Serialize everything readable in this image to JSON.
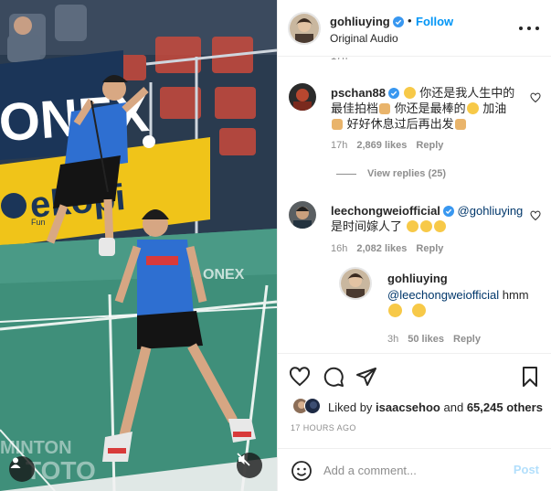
{
  "media": {
    "banner_left": "ONEX",
    "banner_sponsor": "ekopi",
    "banner_small": "Fun",
    "banner_court": "ONEX",
    "watermark_1": "MINTON",
    "watermark_2": "TOTO",
    "colors": {
      "court": "#3f8f7a",
      "wall": "#1b3558",
      "sponsor_yellow": "#f0c419",
      "shirt": "#2e6fd1"
    }
  },
  "header": {
    "username": "gohliuying",
    "separator": "•",
    "follow_label": "Follow",
    "audio": "Original Audio",
    "more_icon": "more-horizontal-icon"
  },
  "comments": {
    "cut_meta": "17h",
    "items": [
      {
        "username": "pschan88",
        "line1": "你还是我人生中的",
        "line2": "最佳拍档",
        "line2b": "你还是最棒的",
        "line2c": "加油",
        "line3": "好好休息过后再出发",
        "time": "17h",
        "likes": "2,869 likes",
        "reply": "Reply"
      },
      {
        "username": "leechongweiofficial",
        "mention": "@gohliuying",
        "text": "是时间嫁人了",
        "time": "16h",
        "likes": "2,082 likes",
        "reply": "Reply"
      }
    ],
    "view_replies": "View replies (25)",
    "reply": {
      "username": "gohliuying",
      "mention": "@leechongweiofficial",
      "text": "hmm",
      "time": "3h",
      "likes": "50 likes",
      "reply": "Reply"
    }
  },
  "actions": {
    "liked_by_prefix": "Liked by",
    "liked_by_user": "isaacsehoo",
    "liked_by_and": "and",
    "liked_by_count": "65,245 others",
    "timestamp": "17 HOURS AGO"
  },
  "add_comment": {
    "placeholder": "Add a comment...",
    "post_label": "Post"
  }
}
